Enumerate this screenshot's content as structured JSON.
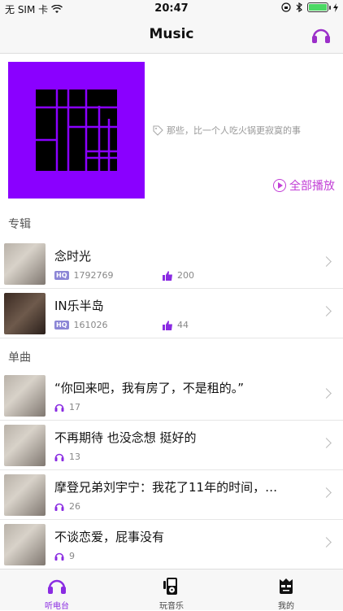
{
  "status_bar": {
    "carrier": "无 SIM 卡",
    "time": "20:47",
    "battery_level": 1.0
  },
  "nav": {
    "title": "Music"
  },
  "hero": {
    "tagline": "那些，比一个人吃火锅更寂寞的事",
    "play_all_label": "全部播放",
    "cover_color": "#8a00ff"
  },
  "sections": {
    "albums_label": "专辑",
    "singles_label": "单曲"
  },
  "albums": [
    {
      "title": "念时光",
      "badge": "HQ",
      "plays": "1792769",
      "likes": "200"
    },
    {
      "title": "IN乐半岛",
      "badge": "HQ",
      "plays": "161026",
      "likes": "44"
    }
  ],
  "singles": [
    {
      "title": "“你回来吧，我有房了，不是租的。”",
      "listens": "17"
    },
    {
      "title": "不再期待 也没念想 挺好的",
      "listens": "13"
    },
    {
      "title": "摩登兄弟刘宇宁：我花了11年的时间，…",
      "listens": "26"
    },
    {
      "title": "不谈恋爱，屁事没有",
      "listens": "9"
    }
  ],
  "tabs": [
    {
      "label": "听电台",
      "icon": "headphone-icon",
      "active": true
    },
    {
      "label": "玩音乐",
      "icon": "music-player-icon",
      "active": false
    },
    {
      "label": "我的",
      "icon": "profile-icon",
      "active": false
    }
  ],
  "colors": {
    "accent": "#c23fd6",
    "tab_active": "#8a2be2"
  }
}
